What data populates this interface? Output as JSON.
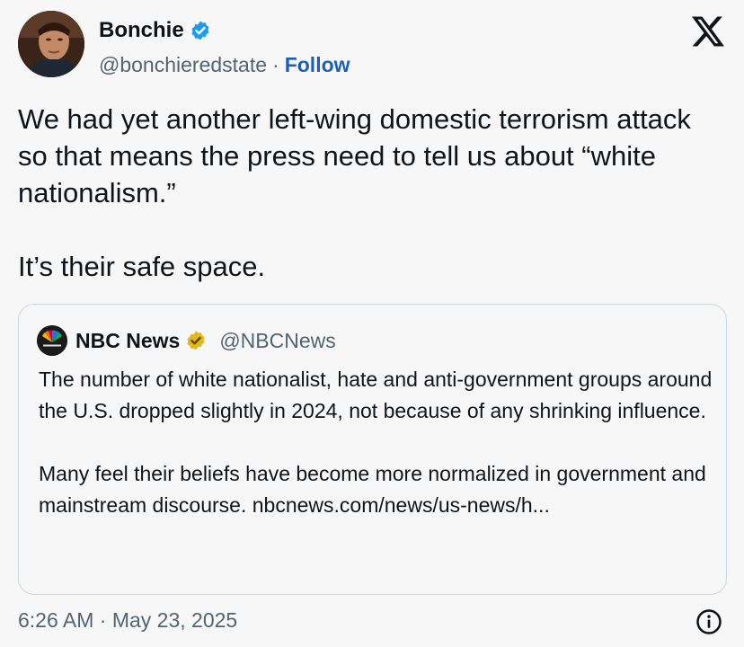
{
  "author": {
    "display_name": "Bonchie",
    "handle": "@bonchieredstate",
    "separator": "·",
    "follow_label": "Follow",
    "verified_icon": "verified-badge-icon",
    "verified_color": "#1d9bf0"
  },
  "platform": {
    "logo_icon": "x-logo-icon"
  },
  "tweet": {
    "paragraph_1": "We had yet another left-wing domestic terrorism attack so that means the press need to tell us about “white nationalism.”",
    "paragraph_2": "It’s their safe space."
  },
  "quoted": {
    "display_name": "NBC News",
    "handle": "@NBCNews",
    "logo_icon": "nbc-peacock-logo",
    "badge_icon": "gold-verified-badge-icon",
    "badge_color": "#e2b719",
    "paragraph_1": "The number of white nationalist, hate and anti-government groups around the U.S. dropped slightly in 2024, not because of any shrinking influence.",
    "paragraph_2": "Many feel their beliefs have become more normalized in government and mainstream discourse. nbcnews.com/news/us-news/h..."
  },
  "meta": {
    "timestamp": "6:26 AM · May 23, 2025",
    "info_icon": "info-icon"
  }
}
